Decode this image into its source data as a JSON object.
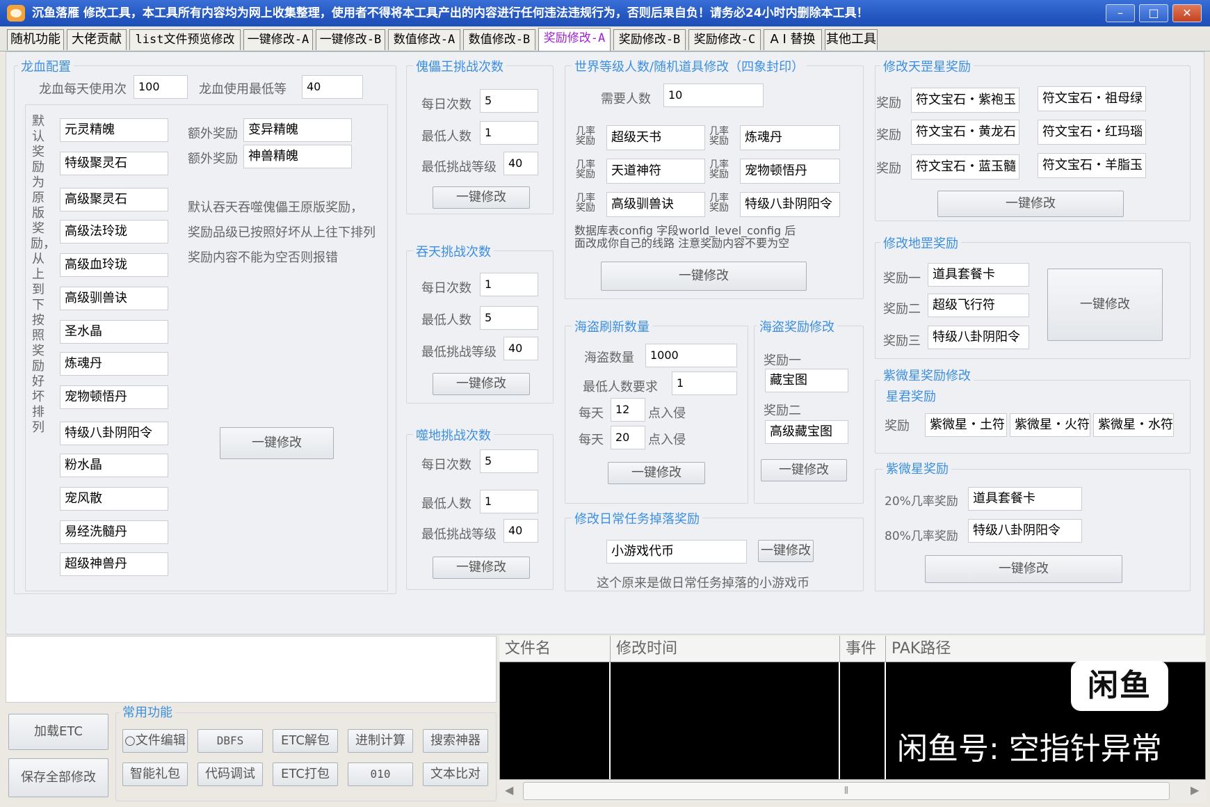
{
  "window": {
    "title": "沉鱼落雁  修改工具，本工具所有内容均为网上收集整理，使用者不得将本工具产出的内容进行任何违法违规行为，否则后果自负！请务必24小时内删除本工具！",
    "minimize": "–",
    "maximize": "□",
    "close": "✕"
  },
  "tabs": [
    "随机功能",
    "大佬贡献",
    "list文件预览修改",
    "一键修改-A",
    "一键修改-B",
    "数值修改-A",
    "数值修改-B",
    "奖励修改-A",
    "奖励修改-B",
    "奖励修改-C",
    "A I 替换",
    "其他工具"
  ],
  "dragon": {
    "title": "龙血配置",
    "daily_label": "龙血每天使用次",
    "daily_value": "100",
    "min_label": "龙血使用最低等",
    "min_value": "40",
    "vertical_text": "默认奖励为原版奖励，从上到下按照奖励好坏排列",
    "items": [
      "元灵精魄",
      "特级聚灵石",
      "高级聚灵石",
      "高级法玲珑",
      "高级血玲珑",
      "高级驯兽诀",
      "圣水晶",
      "炼魂丹",
      "宠物顿悟丹",
      "特级八卦阴阳令",
      "粉水晶",
      "宠风散",
      "易经洗髓丹",
      "超级神兽丹"
    ],
    "extra1_label": "额外奖励",
    "extra1_value": "变异精魄",
    "extra2_label": "额外奖励",
    "extra2_value": "神兽精魄",
    "note1": "默认吞天吞噬傀儡王原版奖励，",
    "note2": "奖励品级已按照好坏从上往下排列",
    "note3": "奖励内容不能为空否则报错",
    "button": "一键修改"
  },
  "puppet": {
    "title": "傀儡王挑战次数",
    "daily_label": "每日次数",
    "daily_value": "5",
    "min_people_label": "最低人数",
    "min_people_value": "1",
    "min_level_label": "最低挑战等级",
    "min_level_value": "40",
    "button": "一键修改"
  },
  "tuntian": {
    "title": "吞天挑战次数",
    "daily_label": "每日次数",
    "daily_value": "1",
    "min_people_label": "最低人数",
    "min_people_value": "5",
    "min_level_label": "最低挑战等级",
    "min_level_value": "40",
    "button": "一键修改"
  },
  "shidi": {
    "title": "噬地挑战次数",
    "daily_label": "每日次数",
    "daily_value": "5",
    "min_people_label": "最低人数",
    "min_people_value": "1",
    "min_level_label": "最低挑战等级",
    "min_level_value": "40",
    "button": "一键修改"
  },
  "world": {
    "title": "世界等级人数/随机道具修改（四象封印）",
    "people_label": "需要人数",
    "people_value": "10",
    "chance_label_top": "几率",
    "chance_label_bottom": "奖励",
    "items": [
      "超级天书",
      "炼魂丹",
      "天道神符",
      "宠物顿悟丹",
      "高级驯兽诀",
      "特级八卦阴阳令"
    ],
    "note1": "数据库表config  字段world_level_config 后",
    "note2": "面改成你自己的线路   注意奖励内容不要为空",
    "button": "一键修改"
  },
  "pirate_refresh": {
    "title": "海盗刷新数量",
    "count_label": "海盗数量",
    "count_value": "1000",
    "min_label": "最低人数要求",
    "min_value": "1",
    "every_label": "每天",
    "time1_value": "12",
    "time2_value": "20",
    "invade_label": "点入侵",
    "button": "一键修改"
  },
  "pirate_reward": {
    "title": "海盗奖励修改",
    "r1_label": "奖励一",
    "r1_value": "藏宝图",
    "r2_label": "奖励二",
    "r2_value": "高级藏宝图",
    "button": "一键修改"
  },
  "daily": {
    "title": "修改日常任务掉落奖励",
    "value": "小游戏代币",
    "button": "一键修改",
    "note": "这个原来是做日常任务掉落的小游戏币"
  },
  "tiangang": {
    "title": "修改天罡星奖励",
    "reward_label": "奖励",
    "items": [
      "符文宝石・紫袍玉",
      "符文宝石・祖母绿",
      "符文宝石・黄龙石",
      "符文宝石・红玛瑙",
      "符文宝石・蓝玉髓",
      "符文宝石・羊脂玉"
    ],
    "button": "一键修改"
  },
  "disha": {
    "title": "修改地罡奖励",
    "labels": [
      "奖励一",
      "奖励二",
      "奖励三"
    ],
    "values": [
      "道具套餐卡",
      "超级飞行符",
      "特级八卦阴阳令"
    ],
    "button": "一键修改"
  },
  "ziwei": {
    "title": "紫微星奖励修改",
    "sub_title": "星君奖励",
    "reward_label": "奖励",
    "items": [
      "紫微星・土符",
      "紫微星・火符",
      "紫微星・水符"
    ]
  },
  "ziwei_reward": {
    "title": "紫微星奖励",
    "p20_label": "20%几率奖励",
    "p20_value": "道具套餐卡",
    "p80_label": "80%几率奖励",
    "p80_value": "特级八卦阴阳令",
    "button": "一键修改"
  },
  "common": {
    "title": "常用功能",
    "load_etc": "加载ETC",
    "save_all": "保存全部修改",
    "row1": [
      "○文件编辑",
      "DBFS",
      "ETC解包",
      "进制计算",
      "搜索神器"
    ],
    "row2": [
      "智能礼包",
      "代码调试",
      "ETC打包",
      "010",
      "文本比对"
    ]
  },
  "filetable": {
    "headers": [
      "文件名",
      "修改时间",
      "事件",
      "PAK路径"
    ],
    "scroll_left": "◀",
    "scroll_right": "▶",
    "scroll_thumb": "⦀"
  },
  "watermark": {
    "logo": "闲鱼",
    "text": "闲鱼号: 空指针异常"
  }
}
